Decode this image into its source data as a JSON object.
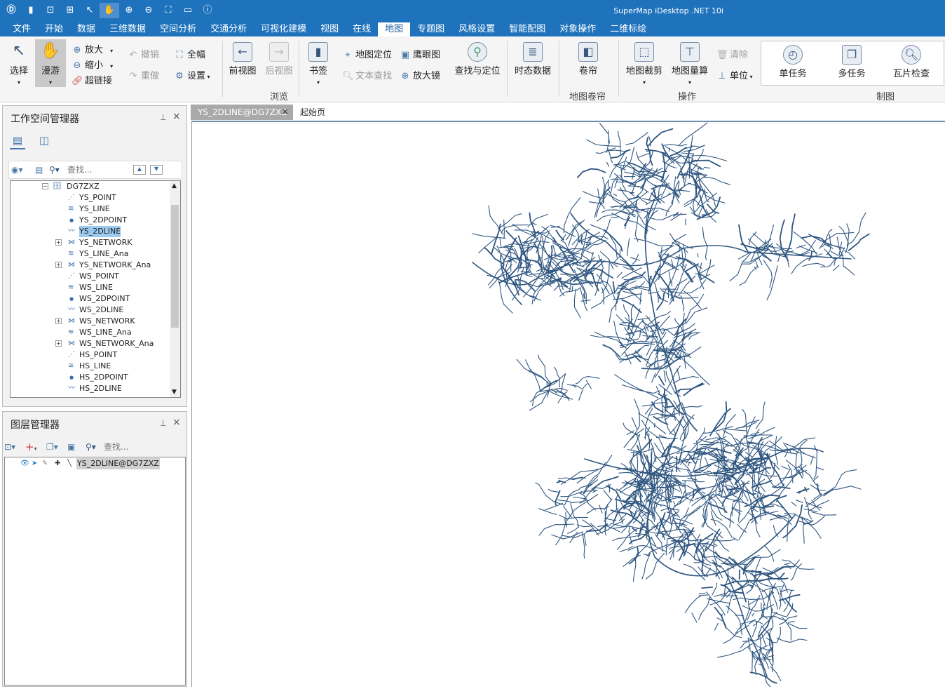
{
  "app": {
    "title": "SuperMap iDesktop .NET 10i"
  },
  "quick_access": [
    "app-logo-icon",
    "save-icon",
    "import-icon",
    "export-icon",
    "select-arrow-icon",
    "pan-hand-icon",
    "zoom-in-icon",
    "zoom-out-icon",
    "full-extent-icon",
    "open-folder-icon",
    "help-icon"
  ],
  "menu": [
    "文件",
    "开始",
    "数据",
    "三维数据",
    "空间分析",
    "交通分析",
    "可视化建模",
    "视图",
    "在线",
    "地图",
    "专题图",
    "风格设置",
    "智能配图",
    "对象操作",
    "二维标绘"
  ],
  "active_menu": "地图",
  "ribbon": {
    "select": "选择",
    "pan": "漫游",
    "zoom_in": "放大",
    "zoom_out": "缩小",
    "hyperlink": "超链接",
    "undo": "撤销",
    "redo": "重做",
    "full_extent": "全幅",
    "settings": "设置",
    "prev_view": "前视图",
    "next_view": "后视图",
    "bookmark": "书签",
    "map_locate": "地图定位",
    "text_search": "文本查找",
    "eagle_eye": "鹰眼图",
    "magnifier": "放大镜",
    "find_locate": "查找与定位",
    "temporal_data": "时态数据",
    "swipe": "卷帘",
    "map_clip": "地图裁剪",
    "map_measure": "地图量算",
    "clear": "清除",
    "unit": "单位",
    "single_task": "单任务",
    "multi_task": "多任务",
    "tile_check": "瓦片检查",
    "group_browse": "浏览",
    "group_swipe": "地图卷帘",
    "group_ops": "操作",
    "group_mapping": "制图"
  },
  "workspace_panel": {
    "title": "工作空间管理器",
    "search_placeholder": "查找...",
    "datasource": "DG7ZXZ",
    "items": [
      {
        "label": "YS_POINT",
        "type": "point3d",
        "expandable": false
      },
      {
        "label": "YS_LINE",
        "type": "line3d",
        "expandable": false
      },
      {
        "label": "YS_2DPOINT",
        "type": "point",
        "expandable": false
      },
      {
        "label": "YS_2DLINE",
        "type": "line",
        "expandable": false,
        "selected": true
      },
      {
        "label": "YS_NETWORK",
        "type": "network",
        "expandable": true
      },
      {
        "label": "YS_LINE_Ana",
        "type": "line3d",
        "expandable": false
      },
      {
        "label": "YS_NETWORK_Ana",
        "type": "network",
        "expandable": true
      },
      {
        "label": "WS_POINT",
        "type": "point3d",
        "expandable": false
      },
      {
        "label": "WS_LINE",
        "type": "line3d",
        "expandable": false
      },
      {
        "label": "WS_2DPOINT",
        "type": "point",
        "expandable": false
      },
      {
        "label": "WS_2DLINE",
        "type": "line",
        "expandable": false
      },
      {
        "label": "WS_NETWORK",
        "type": "network",
        "expandable": true
      },
      {
        "label": "WS_LINE_Ana",
        "type": "line3d",
        "expandable": false
      },
      {
        "label": "WS_NETWORK_Ana",
        "type": "network",
        "expandable": true
      },
      {
        "label": "HS_POINT",
        "type": "point3d",
        "expandable": false
      },
      {
        "label": "HS_LINE",
        "type": "line3d",
        "expandable": false
      },
      {
        "label": "HS_2DPOINT",
        "type": "point",
        "expandable": false
      },
      {
        "label": "HS_2DLINE",
        "type": "line",
        "expandable": false
      }
    ]
  },
  "layer_panel": {
    "title": "图层管理器",
    "search_placeholder": "查找...",
    "layer": "YS_2DLINE@DG7ZXZ"
  },
  "tabs": [
    {
      "label": "YS_2DLINE@DG7ZXZ",
      "active": true,
      "close": "×"
    },
    {
      "label": "起始页",
      "active": false
    }
  ],
  "colors": {
    "ribbon_blue": "#1f73bd",
    "road": "#2f5680",
    "selection": "#9ccbf2"
  }
}
